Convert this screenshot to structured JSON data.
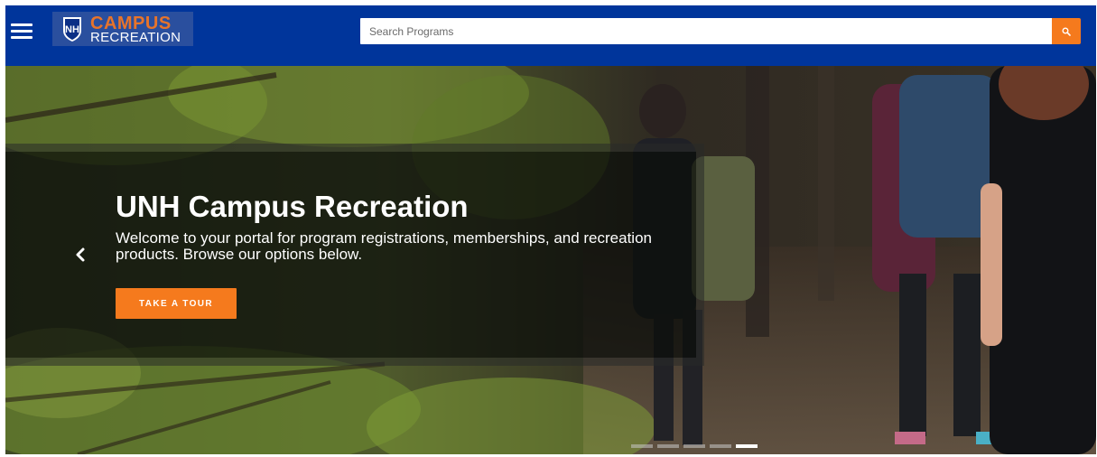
{
  "header": {
    "menu_icon": "hamburger-menu-icon",
    "logo": {
      "line1": "CAMPUS",
      "line2": "RECREATION",
      "shield_icon": "unh-shield-icon",
      "brand_color": "#e8742a"
    },
    "search": {
      "placeholder": "Search Programs",
      "value": "",
      "button_icon": "search-icon"
    },
    "background_color": "#00359b"
  },
  "hero": {
    "title": "UNH Campus Recreation",
    "description": "Welcome to your portal for program registrations, memberships, and recreation products. Browse our options below.",
    "cta_label": "TAKE A TOUR",
    "cta_color": "#f57a1d",
    "prev_icon": "chevron-left-icon",
    "slides_total": 5,
    "active_slide": 5
  }
}
